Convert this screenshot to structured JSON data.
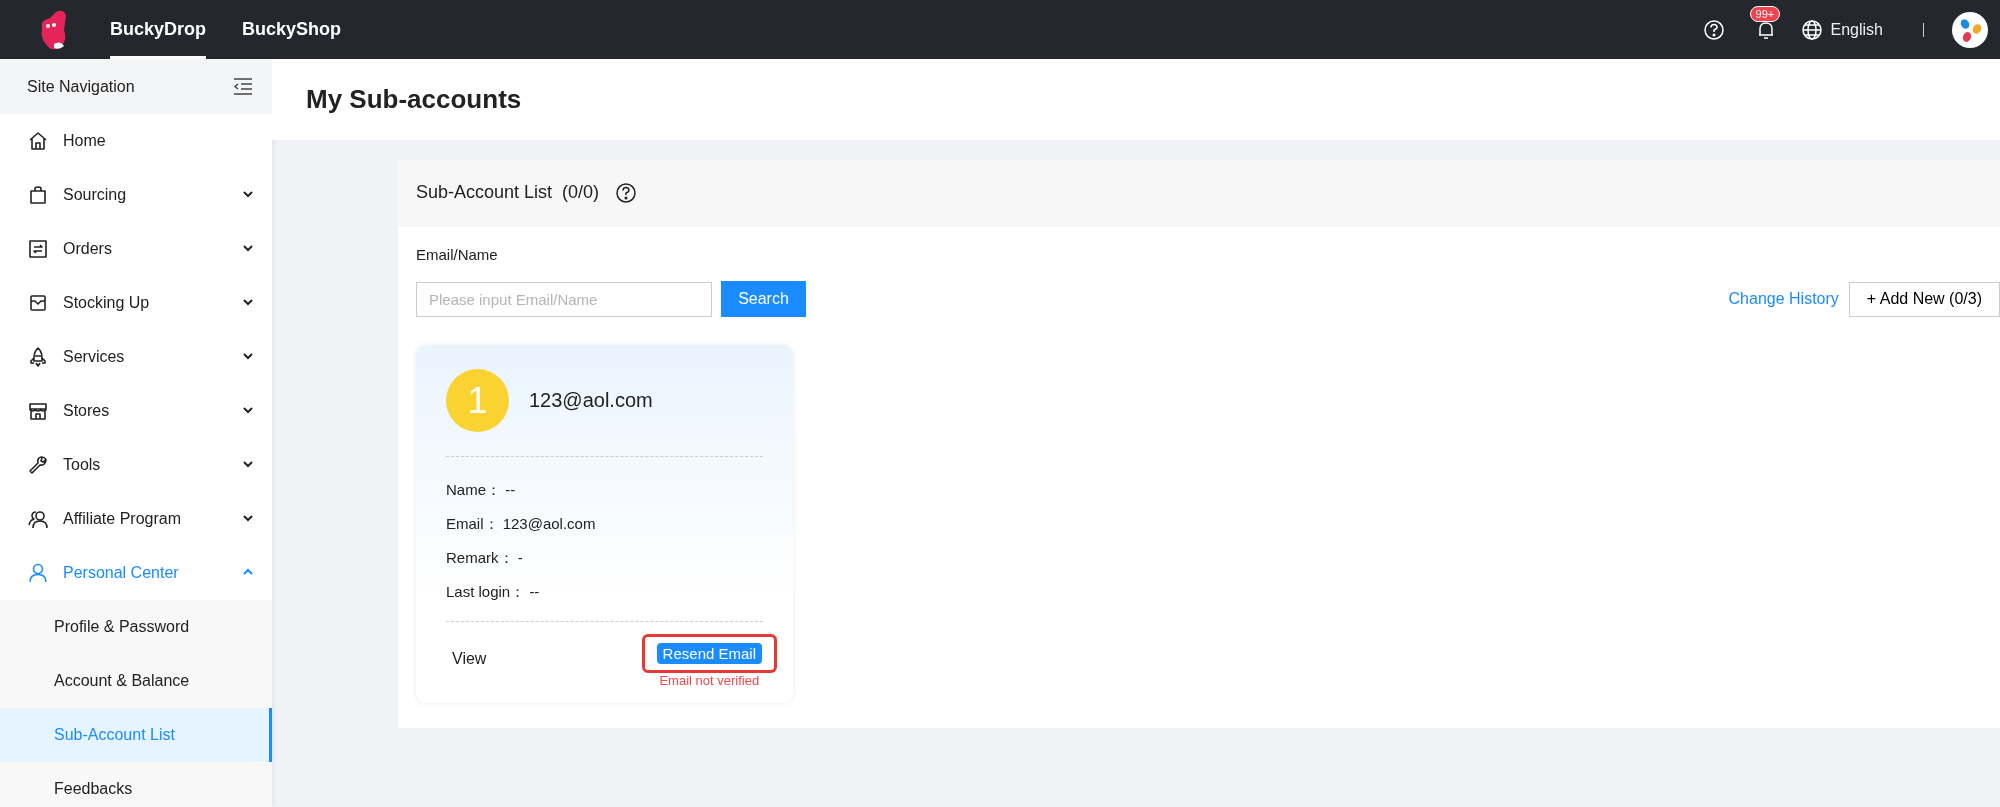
{
  "top_nav": {
    "tabs": [
      {
        "label": "BuckyDrop",
        "selected": true
      },
      {
        "label": "BuckyShop",
        "selected": false
      }
    ],
    "notification_badge": "99+",
    "language": "English"
  },
  "sidebar": {
    "title": "Site Navigation",
    "items": [
      {
        "label": "Home",
        "kind": "home",
        "selected": false
      },
      {
        "label": "Sourcing",
        "kind": "bag",
        "selected": false,
        "expanded": false
      },
      {
        "label": "Orders",
        "kind": "swap",
        "selected": false,
        "expanded": false
      },
      {
        "label": "Stocking Up",
        "kind": "inbox",
        "selected": false,
        "expanded": false
      },
      {
        "label": "Services",
        "kind": "rocket",
        "selected": false,
        "expanded": false
      },
      {
        "label": "Stores",
        "kind": "store",
        "selected": false,
        "expanded": false
      },
      {
        "label": "Tools",
        "kind": "wrench",
        "selected": false,
        "expanded": false
      },
      {
        "label": "Affiliate Program",
        "kind": "people",
        "selected": false,
        "expanded": false
      },
      {
        "label": "Personal Center",
        "kind": "person",
        "selected": true,
        "expanded": true,
        "children": [
          {
            "label": "Profile & Password",
            "selected": false
          },
          {
            "label": "Account & Balance",
            "selected": false
          },
          {
            "label": "Sub-Account List",
            "selected": true
          },
          {
            "label": "Feedbacks",
            "selected": false
          }
        ]
      }
    ]
  },
  "page": {
    "title": "My Sub-accounts"
  },
  "panel": {
    "title": "Sub-Account List",
    "count": "(0/0)",
    "filter": {
      "label": "Email/Name",
      "placeholder": "Please input Email/Name",
      "search_button": "Search"
    },
    "change_history_link": "Change History",
    "add_button": "+ Add New (0/3)",
    "accounts": [
      {
        "index": "1",
        "email": "123@aol.com",
        "details": [
          "Name： --",
          "Email： 123@aol.com",
          "Remark： -",
          "Last login： --"
        ],
        "view_button": "View",
        "resend_button": "Resend Email",
        "resend_highlighted": true,
        "warning": "Email not verified"
      }
    ]
  }
}
